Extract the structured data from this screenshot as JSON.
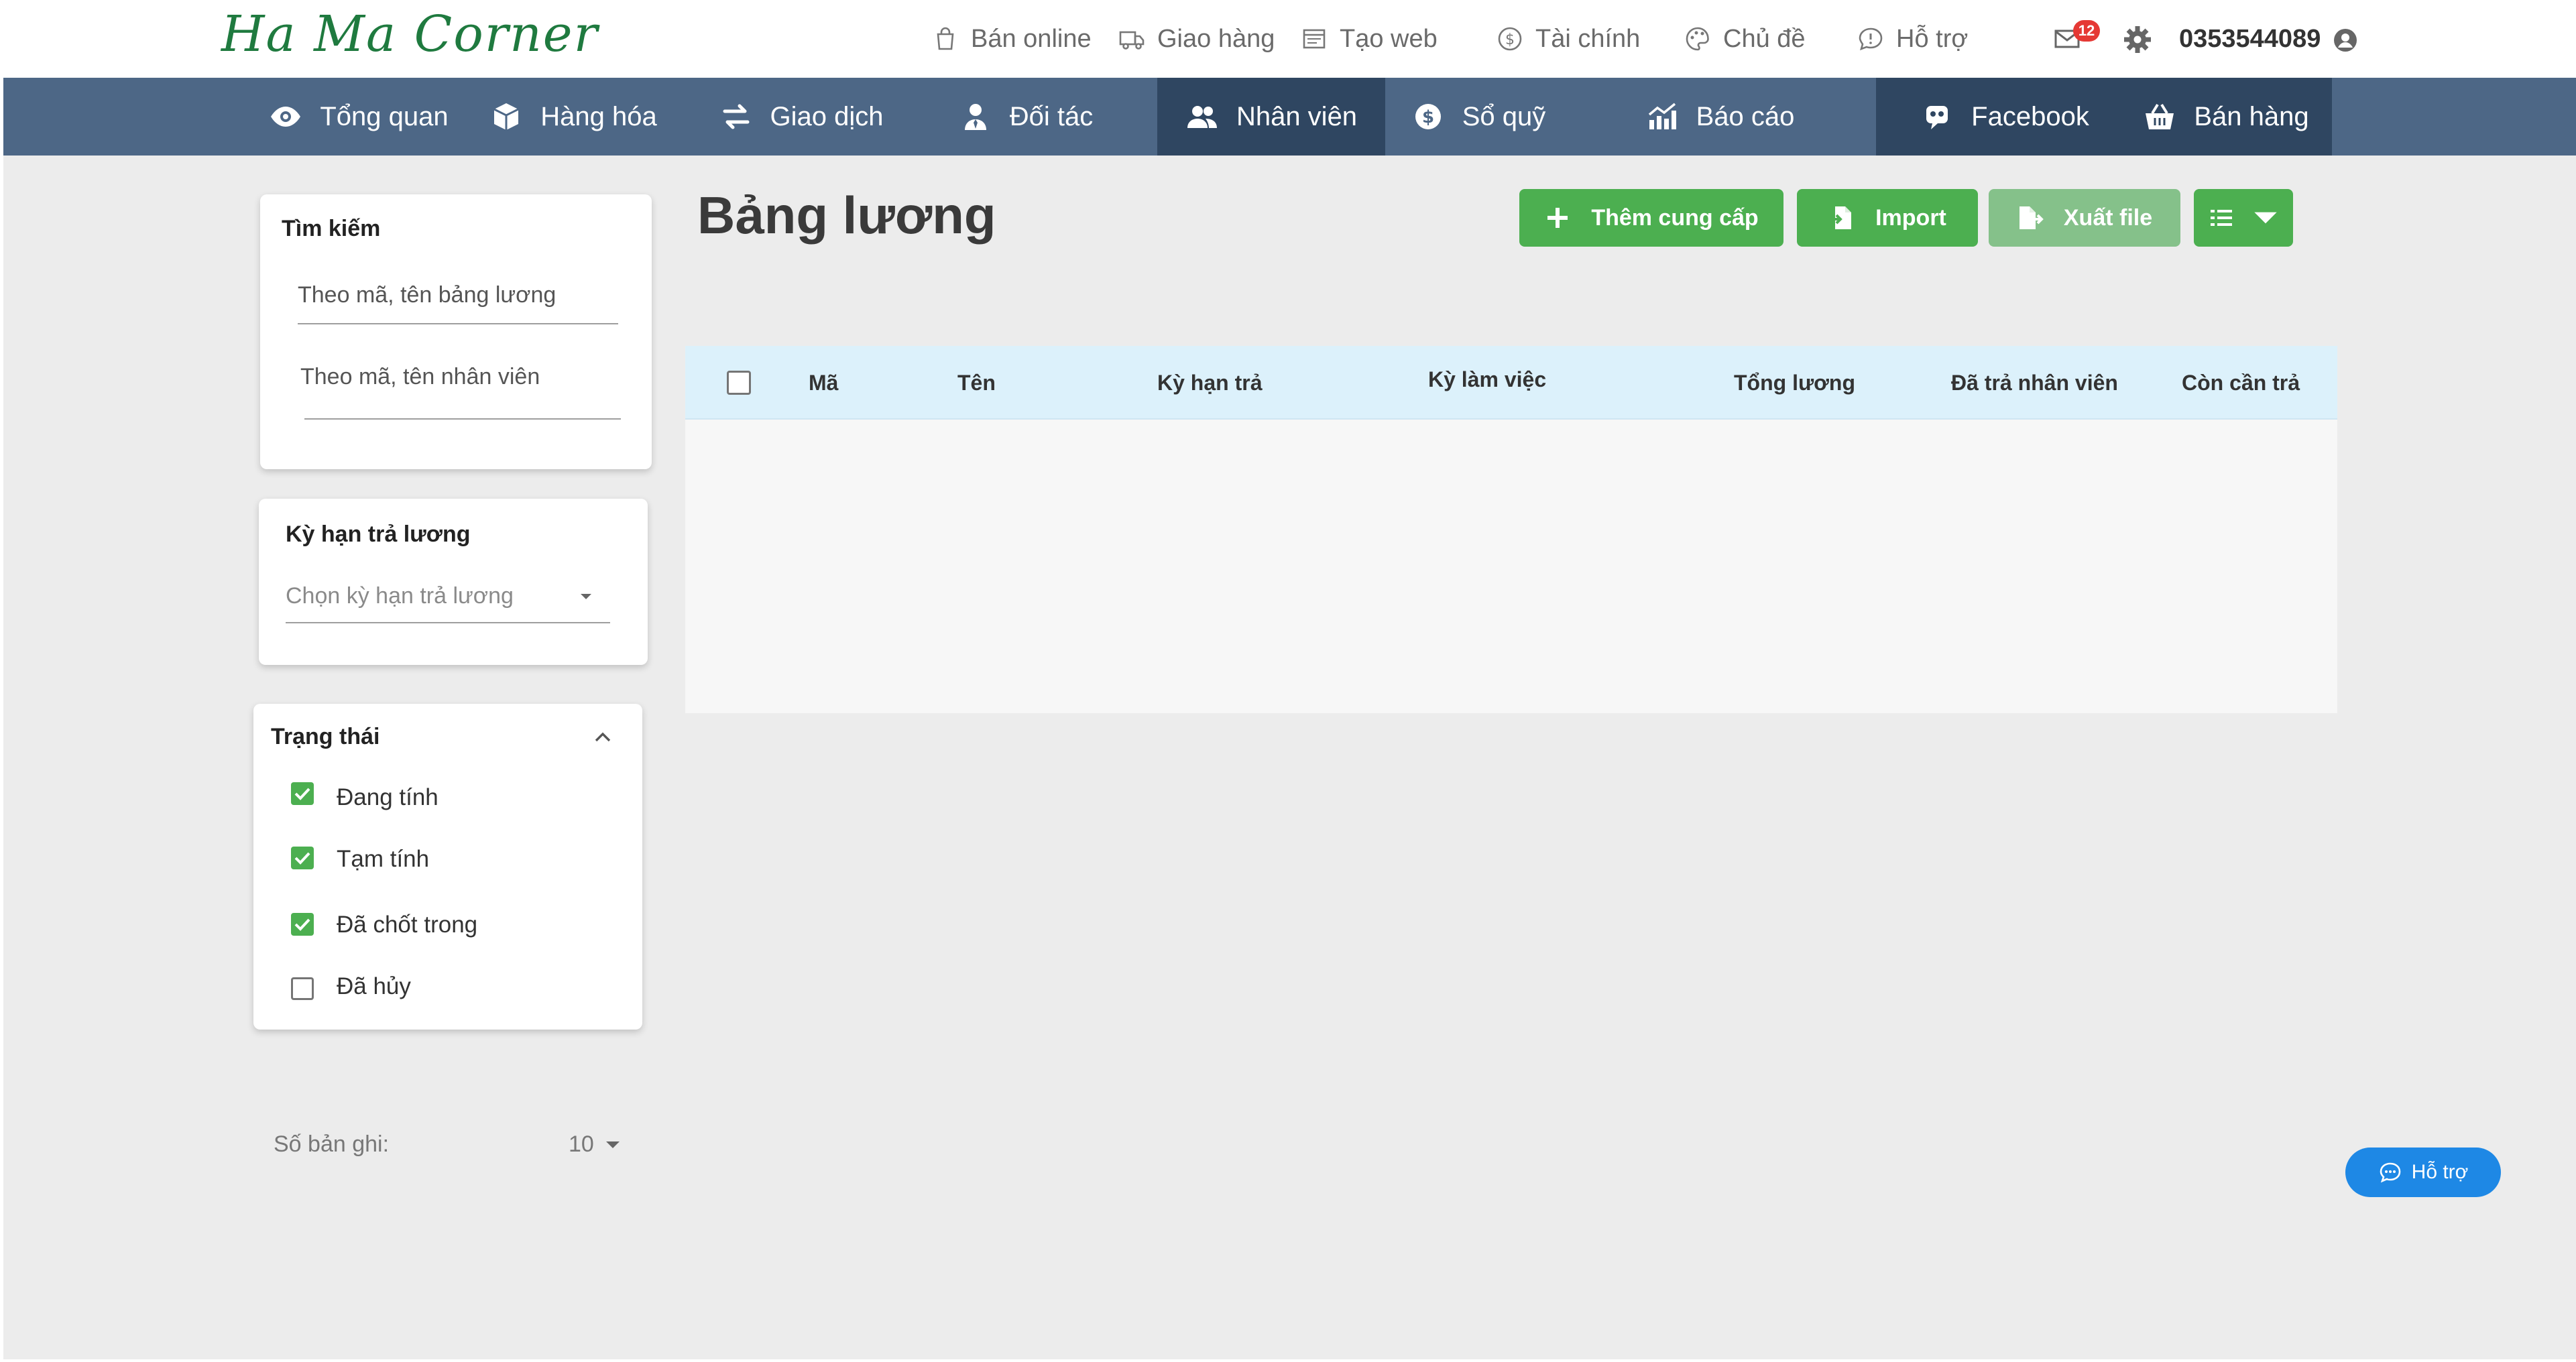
{
  "brand": {
    "logo_text": "Ha Ma Corner"
  },
  "topbar": {
    "links": [
      {
        "label": "Bán online",
        "icon": "shopping-bag-icon"
      },
      {
        "label": "Giao hàng",
        "icon": "truck-icon"
      },
      {
        "label": "Tạo web",
        "icon": "browser-icon"
      },
      {
        "label": "Tài chính",
        "icon": "dollar-circle-icon"
      },
      {
        "label": "Chủ đề",
        "icon": "palette-icon"
      },
      {
        "label": "Hỗ trợ",
        "icon": "chat-alert-icon"
      }
    ],
    "notification_count": "12",
    "phone": "0353544089"
  },
  "nav": {
    "items": [
      {
        "label": "Tổng quan",
        "icon": "eye-icon"
      },
      {
        "label": "Hàng hóa",
        "icon": "box-icon"
      },
      {
        "label": "Giao dịch",
        "icon": "exchange-icon"
      },
      {
        "label": "Đối tác",
        "icon": "user-tie-icon"
      },
      {
        "label": "Nhân viên",
        "icon": "users-icon",
        "active": true
      },
      {
        "label": "Sổ quỹ",
        "icon": "dollar-circle-icon"
      },
      {
        "label": "Báo cáo",
        "icon": "bar-chart-icon"
      },
      {
        "label": "Facebook",
        "icon": "messenger-bot-icon"
      },
      {
        "label": "Bán hàng",
        "icon": "basket-icon"
      }
    ]
  },
  "filters": {
    "search": {
      "title": "Tìm kiếm",
      "payroll_placeholder": "Theo mã, tên bảng lương",
      "employee_placeholder": "Theo mã, tên nhân viên"
    },
    "pay_period": {
      "title": "Kỳ hạn trả lương",
      "placeholder": "Chọn kỳ hạn trả lương"
    },
    "status": {
      "title": "Trạng thái",
      "options": [
        {
          "label": "Đang tính",
          "checked": true
        },
        {
          "label": "Tạm tính",
          "checked": true
        },
        {
          "label": "Đã chốt trong",
          "checked": true
        },
        {
          "label": "Đã hủy",
          "checked": false
        }
      ]
    },
    "records": {
      "label": "Số bản ghi:",
      "value": "10"
    }
  },
  "main": {
    "title": "Bảng lương",
    "buttons": {
      "add": "Thêm cung cấp",
      "import": "Import",
      "export": "Xuất file"
    },
    "table": {
      "columns": [
        "Mã",
        "Tên",
        "Kỳ hạn trả",
        "Kỳ làm việc",
        "Tổng lương",
        "Đã trả nhân viên",
        "Còn cần trả"
      ],
      "rows": []
    }
  },
  "help_button": {
    "label": "Hỗ trợ"
  },
  "colors": {
    "nav_bg": "#4d6786",
    "nav_active": "#2f4661",
    "primary_green": "#4caf50",
    "table_header": "#dcf1fb",
    "badge_red": "#e53935",
    "help_blue": "#1e88e5",
    "logo_green": "#1f7a3f"
  }
}
